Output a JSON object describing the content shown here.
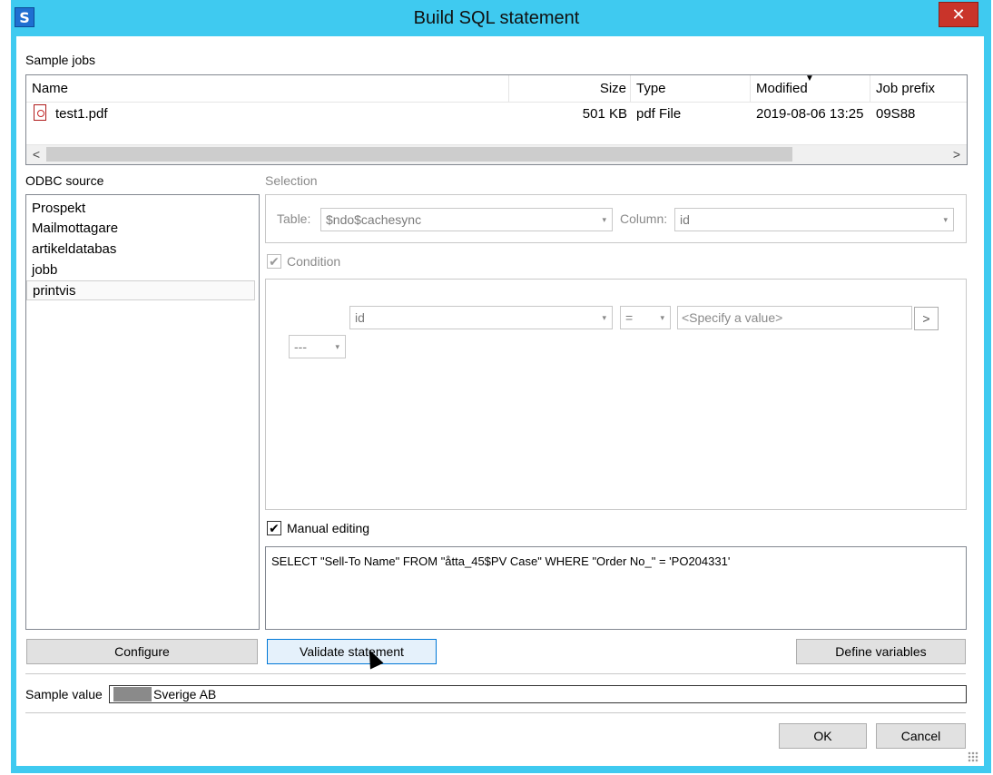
{
  "window": {
    "title": "Build SQL statement",
    "app_icon": "S",
    "close_glyph": "✕"
  },
  "sample_jobs": {
    "label": "Sample jobs",
    "columns": [
      "Name",
      "Size",
      "Type",
      "Modified",
      "Job prefix"
    ],
    "rows": [
      {
        "name": "test1.pdf",
        "size": "501 KB",
        "type": "pdf File",
        "modified": "2019-08-06 13:25",
        "prefix": "09S88"
      }
    ],
    "scroll_left": "<",
    "scroll_right": ">"
  },
  "odbc": {
    "label": "ODBC source",
    "items": [
      "Prospekt",
      "Mailmottagare",
      "artikeldatabas",
      "jobb",
      "printvis"
    ],
    "selected_index": 4
  },
  "selection": {
    "label": "Selection",
    "table_label": "Table:",
    "table_value": "$ndo$cachesync",
    "column_label": "Column:",
    "column_value": "id"
  },
  "condition": {
    "label": "Condition",
    "checked": true,
    "field_value": "id",
    "operator_value": "=",
    "value_placeholder": "<Specify a value>",
    "go_button": ">",
    "connector_value": "---"
  },
  "manual_editing": {
    "label": "Manual editing",
    "checked": true,
    "sql": "SELECT \"Sell-To Name\" FROM \"åtta_45$PV Case\" WHERE \"Order No_\" = 'PO204331'"
  },
  "buttons": {
    "configure": "Configure",
    "validate": "Validate statement",
    "define_variables": "Define variables",
    "ok": "OK",
    "cancel": "Cancel"
  },
  "sample_value": {
    "label": "Sample value",
    "value": "Sverige AB"
  },
  "icons": {
    "dropdown": "▾",
    "check": "✔"
  }
}
